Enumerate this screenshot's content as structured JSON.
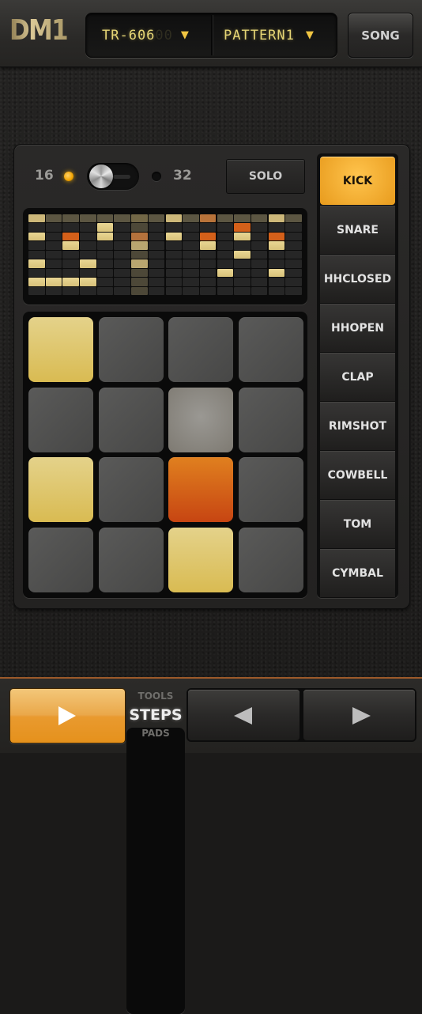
{
  "header": {
    "logo": "DM1",
    "kit": {
      "value": "TR-606",
      "ghost": "00",
      "icon": "dropdown-arrow-icon",
      "arrow": "▼"
    },
    "pattern": {
      "value": "PATTERN1",
      "ghost": "",
      "icon": "dropdown-arrow-icon",
      "arrow": "▼"
    },
    "song_label": "SONG"
  },
  "controls": {
    "length_low": "16",
    "length_high": "32",
    "selected_length": 16,
    "solo_label": "SOLO"
  },
  "sequencer": {
    "steps": 16,
    "playhead_step": 7,
    "selected_instrument": 0,
    "pattern": [
      [
        1,
        0,
        0,
        0,
        0,
        0,
        0,
        0,
        1,
        0,
        2,
        0,
        0,
        0,
        1,
        0
      ],
      [
        0,
        0,
        0,
        0,
        1,
        0,
        0,
        0,
        0,
        0,
        0,
        0,
        2,
        0,
        0,
        0
      ],
      [
        1,
        0,
        2,
        0,
        1,
        0,
        2,
        0,
        1,
        0,
        2,
        0,
        1,
        0,
        2,
        0
      ],
      [
        0,
        0,
        1,
        0,
        0,
        0,
        1,
        0,
        0,
        0,
        1,
        0,
        0,
        0,
        1,
        0
      ],
      [
        0,
        0,
        0,
        0,
        0,
        0,
        0,
        0,
        0,
        0,
        0,
        0,
        1,
        0,
        0,
        0
      ],
      [
        1,
        0,
        0,
        1,
        0,
        0,
        1,
        0,
        0,
        0,
        0,
        0,
        0,
        0,
        0,
        0
      ],
      [
        0,
        0,
        0,
        0,
        0,
        0,
        0,
        0,
        0,
        0,
        0,
        1,
        0,
        0,
        1,
        0
      ],
      [
        1,
        1,
        1,
        1,
        0,
        0,
        0,
        0,
        0,
        0,
        0,
        0,
        0,
        0,
        0,
        0
      ],
      [
        0,
        0,
        0,
        0,
        0,
        0,
        0,
        0,
        0,
        0,
        0,
        0,
        0,
        0,
        0,
        0
      ]
    ]
  },
  "instruments": [
    {
      "label": "KICK",
      "active": true
    },
    {
      "label": "SNARE",
      "active": false
    },
    {
      "label": "HHCLOSED",
      "active": false
    },
    {
      "label": "HHOPEN",
      "active": false
    },
    {
      "label": "CLAP",
      "active": false
    },
    {
      "label": "RIMSHOT",
      "active": false
    },
    {
      "label": "COWBELL",
      "active": false
    },
    {
      "label": "TOM",
      "active": false
    },
    {
      "label": "CYMBAL",
      "active": false
    }
  ],
  "footer": {
    "play_icon": "play-icon",
    "modes": {
      "tools": "TOOLS",
      "steps": "STEPS",
      "pads": "PADS",
      "selected": "STEPS"
    },
    "prev_icon": "previous-icon",
    "next_icon": "next-icon"
  },
  "colors": {
    "accent": "#e89b1d",
    "step_on": "#e0cc85",
    "step_accent": "#d4601a",
    "lcd": "#e5d575"
  }
}
